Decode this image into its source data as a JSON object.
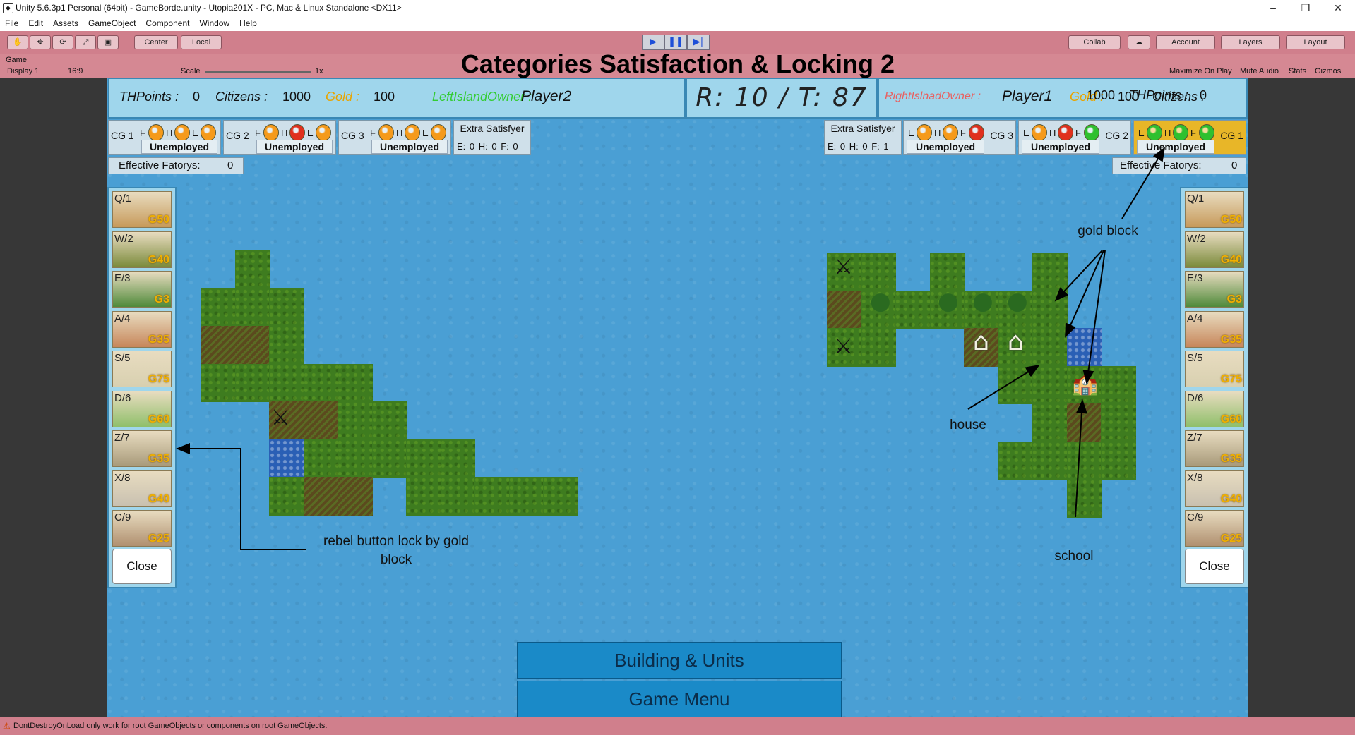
{
  "window": {
    "title": "Unity 5.6.3p1 Personal (64bit) - GameBorde.unity - Utopia201X - PC, Mac & Linux Standalone <DX11>",
    "minimize": "–",
    "maximize": "❐",
    "close": "✕"
  },
  "menu": [
    "File",
    "Edit",
    "Assets",
    "GameObject",
    "Component",
    "Window",
    "Help"
  ],
  "toolbar": {
    "center": "Center",
    "local": "Local",
    "collab": "Collab",
    "account": "Account",
    "layers": "Layers",
    "layout": "Layout"
  },
  "gameview": {
    "tab": "Game",
    "display": "Display 1",
    "aspect": "16:9",
    "scale_label": "Scale",
    "scale_value": "1x",
    "maximize": "Maximize On Play",
    "mute": "Mute Audio",
    "stats": "Stats",
    "gizmos": "Gizmos"
  },
  "title": "Categories Satisfaction & Locking 2",
  "hud_left": {
    "thpoints_label": "THPoints :",
    "thpoints": "0",
    "citizens_label": "Citizens :",
    "citizens": "1000",
    "gold_label": "Gold :",
    "gold": "100",
    "owner_label": "LeftIslandOwner :",
    "player": "Player2"
  },
  "hud_center": {
    "r_label": "R:",
    "r": "10",
    "sep": "/",
    "t_label": "T:",
    "t": "87"
  },
  "hud_right": {
    "owner_label": "RightIslnadOwner :",
    "player": "Player1",
    "gold_label": "Gold :",
    "gold": "100",
    "citizens_label": "Citizens :",
    "citizens": "1000",
    "thpoints_label": "THPoints :",
    "thpoints": "0"
  },
  "cg_left": [
    {
      "label": "CG 1",
      "letters": [
        "F",
        "H",
        "E"
      ],
      "colors": [
        "#f59a1b",
        "#f59a1b",
        "#f59a1b"
      ],
      "status": "Unemployed"
    },
    {
      "label": "CG 2",
      "letters": [
        "F",
        "H",
        "E"
      ],
      "colors": [
        "#f59a1b",
        "#e0301e",
        "#f59a1b"
      ],
      "status": "Unemployed"
    },
    {
      "label": "CG 3",
      "letters": [
        "F",
        "H",
        "E"
      ],
      "colors": [
        "#f59a1b",
        "#f59a1b",
        "#f59a1b"
      ],
      "status": "Unemployed"
    }
  ],
  "cg_right": [
    {
      "label": "CG 3",
      "letters": [
        "E",
        "H",
        "F"
      ],
      "colors": [
        "#f59a1b",
        "#f59a1b",
        "#e0301e"
      ],
      "status": "Unemployed"
    },
    {
      "label": "CG 2",
      "letters": [
        "E",
        "H",
        "F"
      ],
      "colors": [
        "#f59a1b",
        "#e0301e",
        "#2fc02f"
      ],
      "status": "Unemployed"
    },
    {
      "label": "CG 1",
      "letters": [
        "E",
        "H",
        "F"
      ],
      "colors": [
        "#2fc02f",
        "#2fc02f",
        "#2fc02f"
      ],
      "status": "Unemployed"
    }
  ],
  "extra_left": {
    "title": "Extra Satisfyer",
    "values": "E: 0  H: 0  F: 0"
  },
  "extra_right": {
    "title": "Extra Satisfyer",
    "values": "E: 0  H: 0  F: 1"
  },
  "effective": {
    "label": "Effective Fatorys:",
    "left": "0",
    "right": "0"
  },
  "buttons": [
    {
      "code": "Q/1",
      "cost": "G50"
    },
    {
      "code": "W/2",
      "cost": "G40"
    },
    {
      "code": "E/3",
      "cost": "G3"
    },
    {
      "code": "A/4",
      "cost": "G35"
    },
    {
      "code": "S/5",
      "cost": "G75"
    },
    {
      "code": "D/6",
      "cost": "G60"
    },
    {
      "code": "Z/7",
      "cost": "G35"
    },
    {
      "code": "X/8",
      "cost": "G40"
    },
    {
      "code": "C/9",
      "cost": "G25"
    }
  ],
  "close_label": "Close",
  "annotations": {
    "rebel": "rebel button lock by gold block",
    "gold_block": "gold block",
    "house": "house",
    "school": "school"
  },
  "bottom": {
    "building": "Building & Units",
    "menu": "Game Menu"
  },
  "status": "DontDestroyOnLoad only work for root GameObjects or components on root GameObjects."
}
